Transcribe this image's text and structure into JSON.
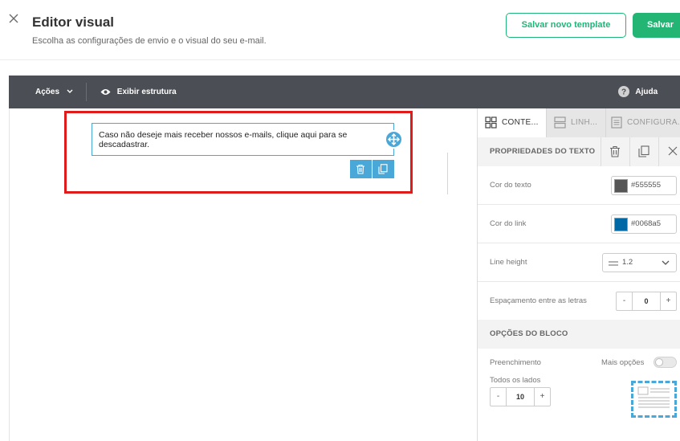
{
  "header": {
    "title": "Editor visual",
    "subtitle": "Escolha as configurações de envio e o visual do seu e-mail.",
    "save_template_label": "Salvar novo template",
    "save_label": "Salvar"
  },
  "toolbar": {
    "actions_label": "Ações",
    "structure_label": "Exibir estrutura",
    "help_label": "Ajuda"
  },
  "canvas": {
    "text_block": "Caso não deseje mais receber nossos e-mails, clique aqui para se descadastrar."
  },
  "panel": {
    "tabs": [
      {
        "label": "CONTE..."
      },
      {
        "label": "LINH..."
      },
      {
        "label": "CONFIGURA..."
      }
    ],
    "text_props_title": "PROPRIEDADES DO TEXTO",
    "text_color_label": "Cor do texto",
    "text_color_value": "#555555",
    "link_color_label": "Cor do link",
    "link_color_value": "#0068a5",
    "line_height_label": "Line height",
    "line_height_value": "1.2",
    "letter_spacing_label": "Espaçamento entre as letras",
    "letter_spacing_value": "0",
    "block_options_title": "OPÇÕES DO BLOCO",
    "padding_label": "Preenchimento",
    "more_options_label": "Mais opções",
    "all_sides_label": "Todos os lados",
    "padding_value": "10",
    "minus": "-",
    "plus": "+"
  },
  "colors": {
    "accent_green": "#22b573",
    "toolbar_bg": "#4b4f55",
    "selection_red": "#e01b1b",
    "block_blue": "#4aa8d8"
  }
}
